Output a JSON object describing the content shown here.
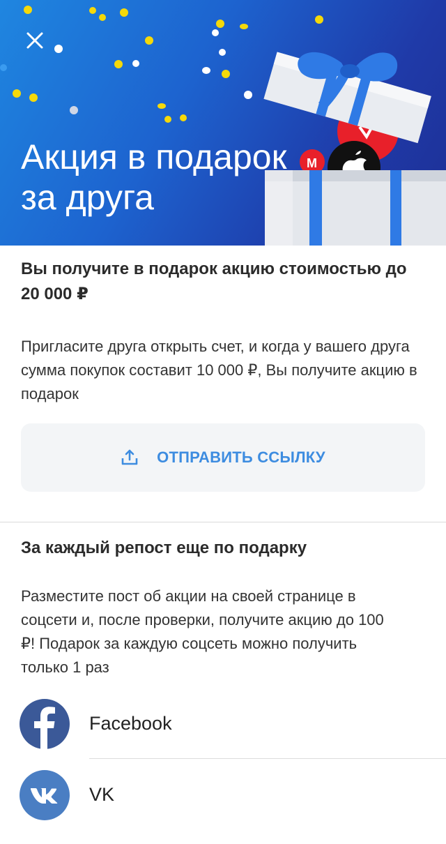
{
  "hero": {
    "title_line1": "Акция в подарок",
    "title_line2": "за друга",
    "close_icon": "close-icon",
    "colors": {
      "gradient_start": "#1f86e0",
      "gradient_end": "#1e2f95"
    }
  },
  "referral": {
    "heading": "Вы получите в подарок акцию стоимостью до 20 000 ₽",
    "description": "Пригласите друга открыть счет, и когда у вашего друга сумма покупок составит 10 000 ₽, Вы получите акцию в подарок",
    "send_button": {
      "label": "ОТПРАВИТЬ ССЫЛКУ",
      "icon": "share-upload-icon",
      "color": "#3d8ce0"
    }
  },
  "repost": {
    "heading": "За каждый репост еще по подарку",
    "description": "Разместите пост об акции на своей странице в соцсети и, после проверки, получите акцию до 100 ₽! Подарок за каждую соцсеть можно получить только 1 раз"
  },
  "socials": [
    {
      "name": "Facebook",
      "icon": "facebook-icon",
      "color": "#3b5998"
    },
    {
      "name": "VK",
      "icon": "vk-icon",
      "color": "#4a7ec3"
    }
  ]
}
